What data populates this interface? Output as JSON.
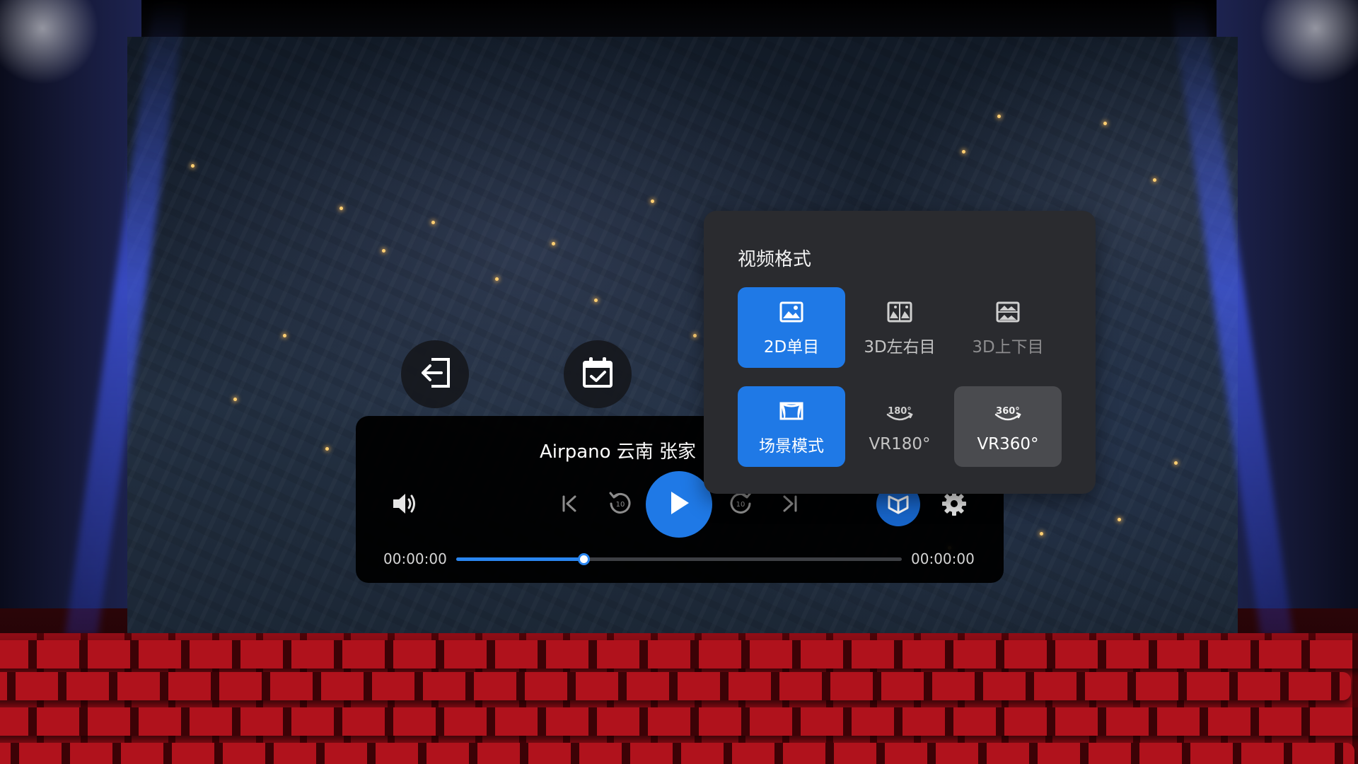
{
  "player": {
    "title": "Airpano 云南 张家",
    "time_current": "00:00:00",
    "time_total": "00:00:00",
    "progress": 0.285
  },
  "format_menu": {
    "title": "视频格式",
    "options": [
      {
        "label": "2D单目",
        "icon": "image-icon",
        "state": "selected"
      },
      {
        "label": "3D左右目",
        "icon": "side-by-side-image-icon",
        "state": "normal"
      },
      {
        "label": "3D上下目",
        "icon": "top-bottom-image-icon",
        "state": "disabled"
      },
      {
        "label": "场景模式",
        "icon": "theater-screen-icon",
        "state": "selected"
      },
      {
        "label": "VR180°",
        "icon": "vr180-icon",
        "state": "normal"
      },
      {
        "label": "VR360°",
        "icon": "vr360-icon",
        "state": "hover"
      }
    ]
  },
  "icons": {
    "exit": "exit-icon",
    "schedule": "calendar-check-icon",
    "volume": "volume-icon",
    "previous": "skip-previous-icon",
    "rewind": "replay-10-icon",
    "play": "play-icon",
    "forward": "forward-10-icon",
    "next": "skip-next-icon",
    "format": "video-format-icon",
    "settings": "gear-icon"
  },
  "colors": {
    "accent": "#1f79e6",
    "panel": "#2a2b2f",
    "player_bg": "#000000",
    "seat_red": "#b0121c"
  }
}
